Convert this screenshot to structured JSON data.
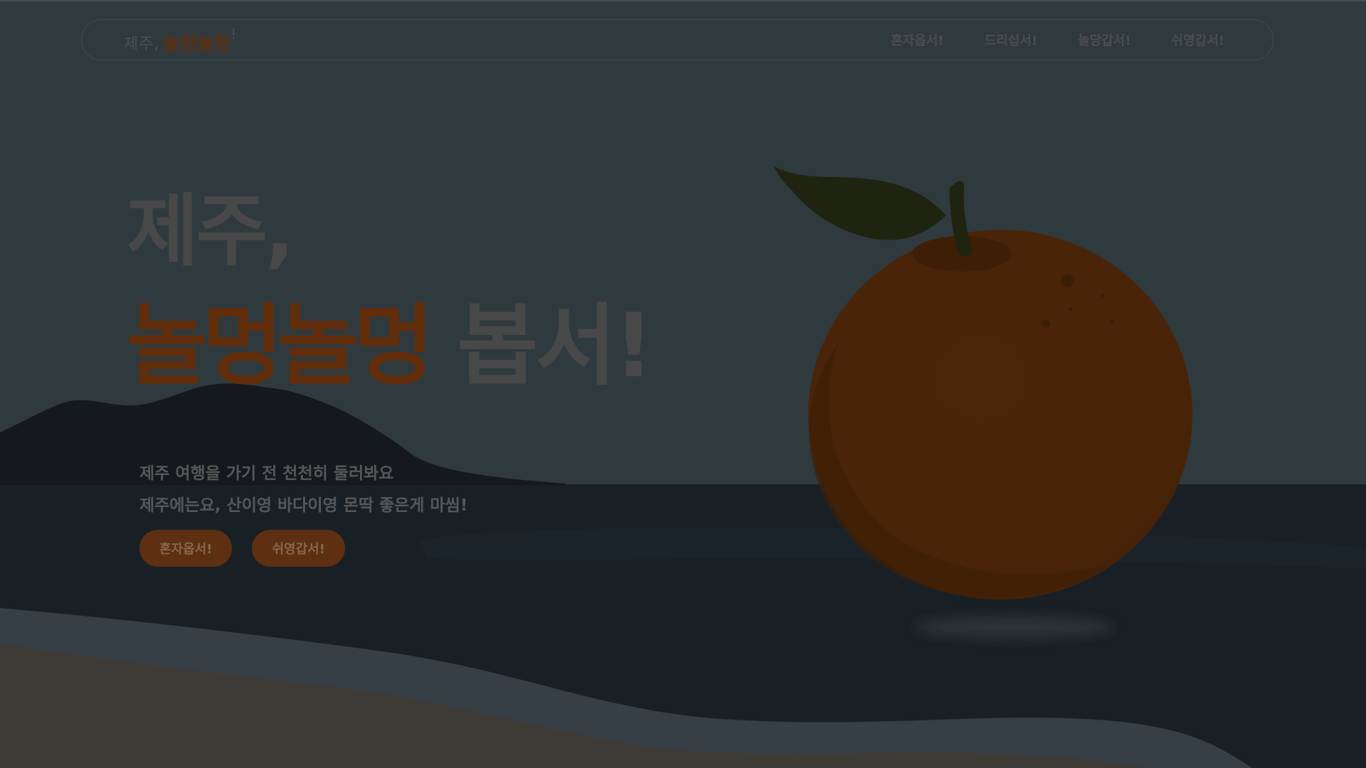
{
  "brand": {
    "prefix": "제주,",
    "main": "놀멍놀멍",
    "suffix": "!"
  },
  "nav": {
    "items": [
      {
        "label": "혼자옵서!"
      },
      {
        "label": "드리십서!"
      },
      {
        "label": "놀당갑서!"
      },
      {
        "label": "쉬영갑서!"
      }
    ]
  },
  "hero": {
    "line1": "제주,",
    "line2_accent": "놀멍놀멍",
    "line2_rest": "봅서!"
  },
  "subtitle": {
    "line1": "제주 여행을 가기 전 천천히 둘러봐요",
    "line2": "제주에는요, 산이영 바다이영 몬딱 좋은게 마씸!"
  },
  "cta": {
    "primary": "혼자옵서!",
    "secondary": "쉬영갑서!"
  },
  "colors": {
    "sky": "#2f3a3f",
    "sea": "#182026",
    "mountain": "#15191d",
    "wave": "#363f46",
    "sand": "#3e3a35",
    "tangerine": "#5b2a07",
    "leaf": "#1f2410",
    "accent_text": "#612d0b"
  }
}
